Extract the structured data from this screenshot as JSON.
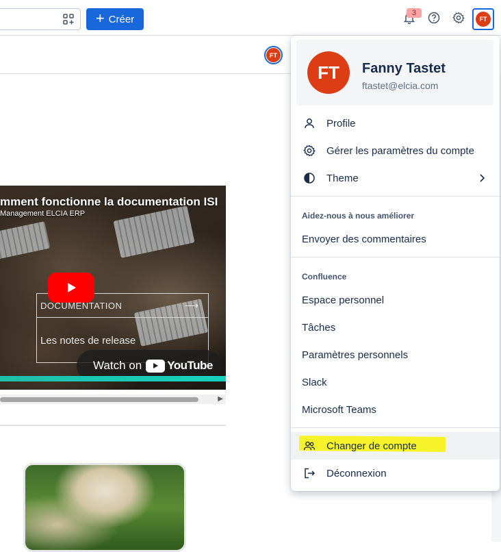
{
  "topbar": {
    "create_label": "Créer",
    "notification_count": "3",
    "avatar_initials": "FT"
  },
  "subbar": {
    "avatar_initials": "FT"
  },
  "video": {
    "title": "mment fonctionne la documentation ISI",
    "subtitle": "Management ELCIA ERP",
    "doc_label": "DOCUMENTATION",
    "notes_label": "Les notes de release",
    "watch_label": "Watch on",
    "youtube_label": "YouTube"
  },
  "profile": {
    "initials": "FT",
    "name": "Fanny Tastet",
    "email": "ftastet@elcia.com"
  },
  "menu": {
    "profile_label": "Profile",
    "settings_label": "Gérer les paramètres du compte",
    "theme_label": "Theme",
    "feedback_section": "Aidez-nous à nous améliorer",
    "feedback_label": "Envoyer des commentaires",
    "confluence_section": "Confluence",
    "confluence_items": [
      "Espace personnel",
      "Tâches",
      "Paramètres personnels",
      "Slack",
      "Microsoft Teams"
    ],
    "switch_label": "Changer de compte",
    "logout_label": "Déconnexion"
  },
  "colors": {
    "brand_blue": "#1868db",
    "avatar_orange": "#dc3d14",
    "highlight_yellow": "#f7f32a"
  },
  "icons": {
    "apps": "apps-icon",
    "plus": "plus-icon",
    "notification": "bell-icon",
    "help": "help-icon",
    "settings": "gear-icon",
    "profile": "person-icon",
    "manage": "gear-icon",
    "theme": "half-circle-icon",
    "switch": "people-icon",
    "logout": "logout-icon"
  }
}
